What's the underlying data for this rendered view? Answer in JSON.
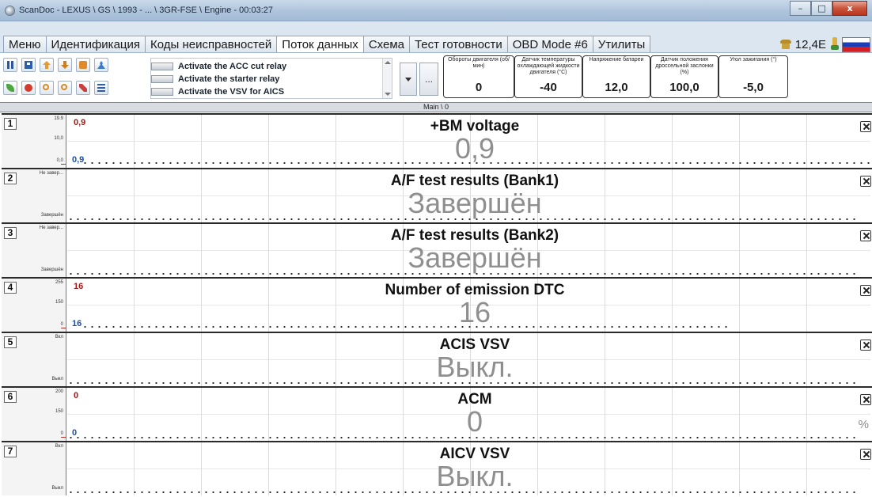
{
  "window": {
    "title": "ScanDoc - LEXUS \\ GS \\ 1993 - ... \\ 3GR-FSE \\ Engine - 00:03:27",
    "minimize_label": "–",
    "maximize_label": "□",
    "close_label": "x"
  },
  "tabs": [
    {
      "label": "Меню"
    },
    {
      "label": "Идентификация"
    },
    {
      "label": "Коды неисправностей"
    },
    {
      "label": "Поток данных",
      "active": true
    },
    {
      "label": "Схема"
    },
    {
      "label": "Тест готовности"
    },
    {
      "label": "OBD Mode #6"
    },
    {
      "label": "Утилиты"
    }
  ],
  "status": {
    "voltage": "12,4E",
    "icons": [
      "phone-icon",
      "plug-icon",
      "russia-flag-icon"
    ]
  },
  "toolbar": {
    "buttons_row1": [
      "pause-icon",
      "save-icon",
      "upload-icon",
      "download-icon",
      "clipboard-icon",
      "person-icon"
    ],
    "buttons_row2": [
      "leaf-icon",
      "record-icon",
      "zoom-in-icon",
      "zoom-out-icon",
      "tools-icon",
      "list-icon"
    ],
    "relays": [
      {
        "label": "Activate the ACC cut relay"
      },
      {
        "label": "Activate the starter relay"
      },
      {
        "label": "Activate the VSV for AICS"
      }
    ],
    "ellipsis_label": "...",
    "gauges": [
      {
        "name": "Обороты двигателя (об/мин)",
        "value": "0"
      },
      {
        "name": "Датчик температуры охлаждающей жидкости двигателя (°С)",
        "value": "-40"
      },
      {
        "name": "Напряжение батареи",
        "value": "12,0"
      },
      {
        "name": "Датчик положения дроссельной заслонки (%)",
        "value": "100,0"
      },
      {
        "name": "Угол зажигания (°)",
        "value": "-5,0"
      }
    ]
  },
  "main": {
    "header": "Main \\ 0",
    "panels": [
      {
        "num": "1",
        "axis_max": "19.9",
        "axis_mid": "10,0",
        "axis_min": "0,0",
        "name": "+BM voltage",
        "value": "0,9",
        "red": "0,9",
        "blue": "0,9",
        "unit": ""
      },
      {
        "num": "2",
        "axis_max": "Не завер...",
        "axis_mid": "",
        "axis_min": "Завершён",
        "name": "A/F test results (Bank1)",
        "value": "Завершён",
        "red": "",
        "blue": "",
        "unit": ""
      },
      {
        "num": "3",
        "axis_max": "Не завер...",
        "axis_mid": "",
        "axis_min": "Завершён",
        "name": "A/F test results (Bank2)",
        "value": "Завершён",
        "red": "",
        "blue": "",
        "unit": ""
      },
      {
        "num": "4",
        "axis_max": "255",
        "axis_mid": "150",
        "axis_min": "0",
        "name": "Number of emission DTC",
        "value": "16",
        "red": "16",
        "blue": "16",
        "unit": ""
      },
      {
        "num": "5",
        "axis_max": "Вкл",
        "axis_mid": "",
        "axis_min": "Выкл",
        "name": "ACIS VSV",
        "value": "Выкл.",
        "red": "",
        "blue": "",
        "unit": ""
      },
      {
        "num": "6",
        "axis_max": "200",
        "axis_mid": "150",
        "axis_min": "0",
        "name": "ACM",
        "value": "0",
        "red": "0",
        "blue": "0",
        "unit": "%"
      },
      {
        "num": "7",
        "axis_max": "Вкл",
        "axis_mid": "",
        "axis_min": "Выкл",
        "name": "AICV VSV",
        "value": "Выкл.",
        "red": "",
        "blue": "",
        "unit": ""
      }
    ]
  }
}
